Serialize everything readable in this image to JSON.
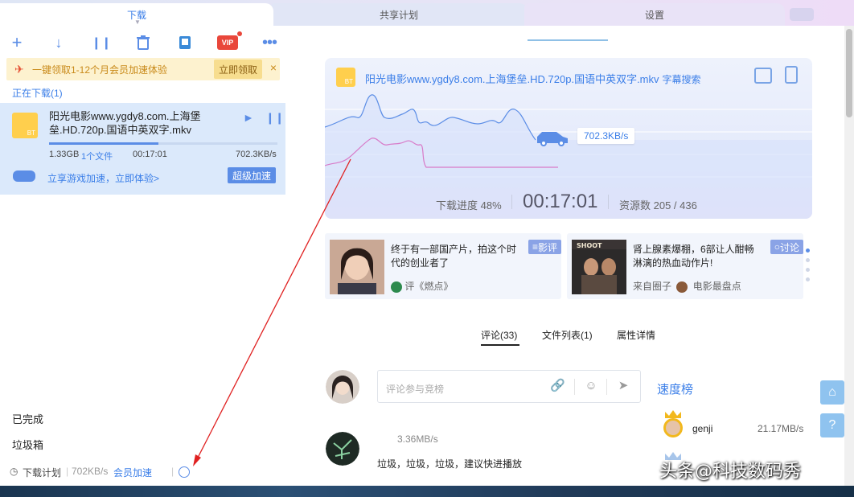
{
  "tabs": [
    {
      "label": "下载",
      "active": true
    },
    {
      "label": "共享计划",
      "active": false
    },
    {
      "label": "设置",
      "active": false
    }
  ],
  "toolbar": {
    "icons": [
      "plus-icon",
      "download-arrow-icon",
      "pause-icon",
      "trash-icon",
      "phone-icon",
      "vip-icon",
      "more-icon"
    ],
    "vip_label": "VIP"
  },
  "promo": {
    "text": "一键领取1-12个月会员加速体验",
    "button": "立即领取",
    "close": "×"
  },
  "downloading": {
    "section_title": "正在下载(1)",
    "task": {
      "name": "阳光电影www.ygdy8.com.上海堡垒.HD.720p.国语中英双字.mkv",
      "size": "1.33GB",
      "file_count": "1个文件",
      "elapsed": "00:17:01",
      "speed": "702.3KB/s",
      "progress": 0.48,
      "game_text": "立享游戏加速，立即体验>",
      "super_button": "超级加速"
    }
  },
  "left_list": {
    "completed": "已完成",
    "trash": "垃圾箱"
  },
  "status_bar": {
    "plan": "下载计划",
    "speed": "702KB/s",
    "member": "会员加速"
  },
  "detail": {
    "title": "阳光电影www.ygdy8.com.上海堡垒.HD.720p.国语中英双字.mkv",
    "subtitle_search": "字幕搜索",
    "speed_tag": "702.3KB/s",
    "progress_label": "下载进度 48%",
    "time": "00:17:01",
    "sources": "资源数 205 / 436"
  },
  "news": [
    {
      "text": "终于有一部国产片，拍这个时代的创业者了",
      "tag": "影评",
      "foot": "评《燃点》"
    },
    {
      "text": "肾上腺素爆棚，6部让人酣畅淋漓的热血动作片!",
      "tag": "讨论",
      "foot_src": "来自圈子",
      "foot_group": "电影最盘点"
    }
  ],
  "subtabs": [
    "评论(33)",
    "文件列表(1)",
    "属性详情"
  ],
  "comment": {
    "placeholder": "评论参与竞榜",
    "item_speed": "3.36MB/s",
    "item_text": "垃圾，垃圾，垃圾，建议快进播放"
  },
  "ranking": {
    "title": "速度榜",
    "entries": [
      {
        "name": "genji",
        "speed": "21.17MB/s"
      }
    ]
  },
  "watermark": "头条@科技数码秀",
  "colors": {
    "accent": "#3a7ee8",
    "annotation": "#e02020",
    "promo_bg": "#fdf2cf"
  }
}
